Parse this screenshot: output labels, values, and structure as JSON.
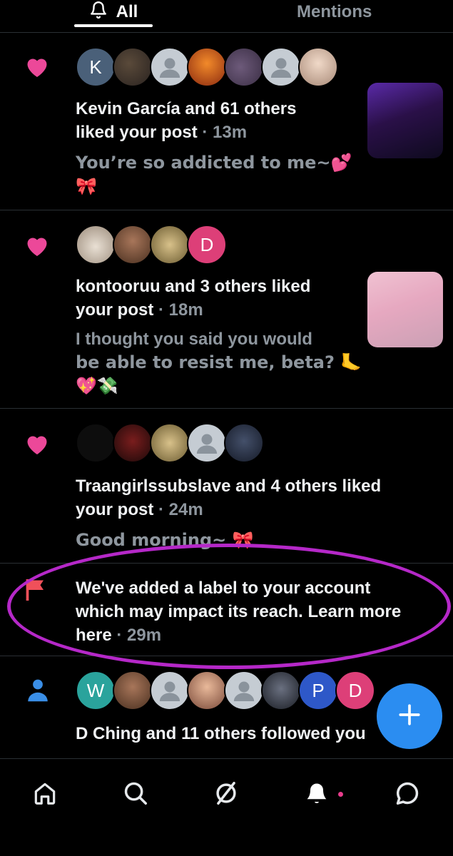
{
  "tabs": {
    "all_label": "All",
    "mentions_label": "Mentions"
  },
  "notifications": [
    {
      "type": "like",
      "avatars": [
        "K",
        "",
        "",
        "",
        "",
        "",
        ""
      ],
      "text": "Kevin García and 61 others",
      "text2": "liked your post",
      "time": "· 13m",
      "sub1": "You’re so addicted to me~💕",
      "sub2": "🎀"
    },
    {
      "type": "like",
      "avatars": [
        "",
        "",
        "",
        "D"
      ],
      "text": "kontooruu and 3 others liked",
      "text2": "your post",
      "time": "· 18m",
      "sub1": "I thought you said you would",
      "sub2": "be able to resist me, beta? 🦶",
      "sub3": "💖💸"
    },
    {
      "type": "like",
      "avatars": [
        "",
        "",
        "",
        "",
        ""
      ],
      "text": "Traangirlssubslave and 4 others liked",
      "text2": "your post",
      "time": "· 24m",
      "sub1": "Good morning~ 🎀"
    },
    {
      "type": "label",
      "text": "We've added a label to your account",
      "text2": "which may impact its reach. Learn more",
      "text3": "here",
      "time": "· 29m"
    },
    {
      "type": "follow",
      "avatars": [
        "W",
        "",
        "",
        "",
        "",
        "",
        "P",
        "D"
      ],
      "text": "D Ching and 11 others followed you"
    }
  ],
  "colors": {
    "heart": "#ec4899",
    "flag": "#f0505a",
    "follow": "#3a8ee6",
    "fab": "#2b8df1",
    "oval": "#b528c8",
    "badge_dot": "#e83c8c"
  },
  "icons": {
    "tab_all": "bell-icon",
    "nav": [
      "home-icon",
      "search-icon",
      "feeds-icon",
      "notifications-bell-icon",
      "chat-icon"
    ],
    "fab": "plus-icon"
  }
}
